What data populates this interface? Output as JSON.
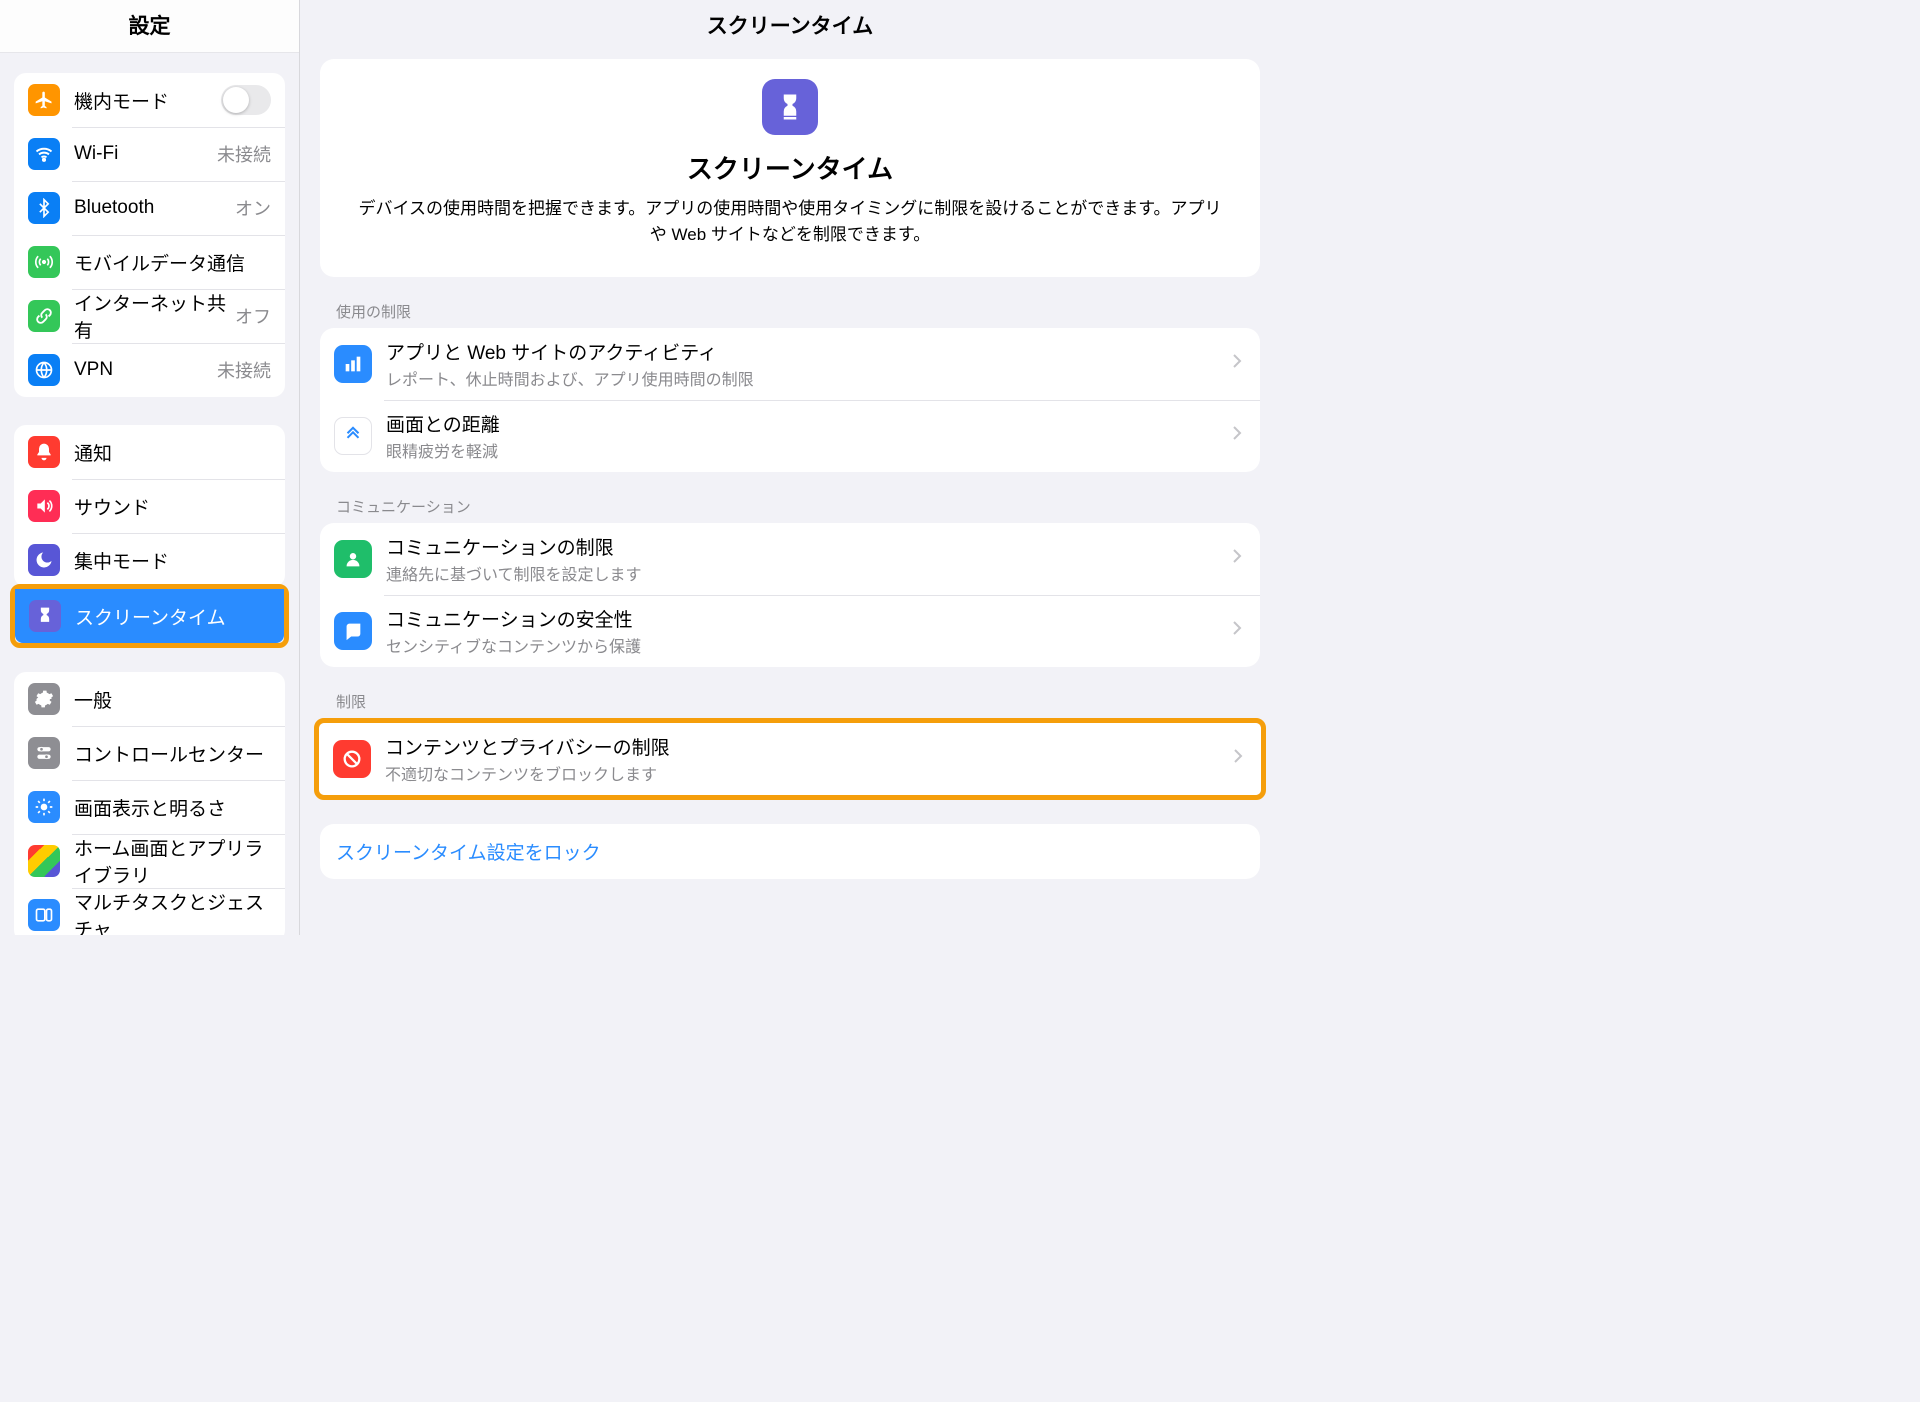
{
  "sidebar": {
    "title": "設定",
    "group1": [
      {
        "label": "機内モード",
        "toggle": true
      },
      {
        "label": "Wi-Fi",
        "value": "未接続"
      },
      {
        "label": "Bluetooth",
        "value": "オン"
      },
      {
        "label": "モバイルデータ通信"
      },
      {
        "label": "インターネット共有",
        "value": "オフ"
      },
      {
        "label": "VPN",
        "value": "未接続"
      }
    ],
    "group2": [
      {
        "label": "通知"
      },
      {
        "label": "サウンド"
      },
      {
        "label": "集中モード"
      },
      {
        "label": "スクリーンタイム",
        "selected": true,
        "highlight": true
      }
    ],
    "group3": [
      {
        "label": "一般"
      },
      {
        "label": "コントロールセンター"
      },
      {
        "label": "画面表示と明るさ"
      },
      {
        "label": "ホーム画面とアプリライブラリ"
      },
      {
        "label": "マルチタスクとジェスチャ"
      }
    ]
  },
  "detail": {
    "title": "スクリーンタイム",
    "hero": {
      "heading": "スクリーンタイム",
      "desc": "デバイスの使用時間を把握できます。アプリの使用時間や使用タイミングに制限を設けることができます。アプリや Web サイトなどを制限できます。"
    },
    "sections": {
      "usage_label": "使用の制限",
      "usage": [
        {
          "title": "アプリと Web サイトのアクティビティ",
          "sub": "レポート、休止時間および、アプリ使用時間の制限"
        },
        {
          "title": "画面との距離",
          "sub": "眼精疲労を軽減"
        }
      ],
      "comm_label": "コミュニケーション",
      "comm": [
        {
          "title": "コミュニケーションの制限",
          "sub": "連絡先に基づいて制限を設定します"
        },
        {
          "title": "コミュニケーションの安全性",
          "sub": "センシティブなコンテンツから保護"
        }
      ],
      "restrict_label": "制限",
      "restrict": [
        {
          "title": "コンテンツとプライバシーの制限",
          "sub": "不適切なコンテンツをブロックします",
          "highlight": true
        }
      ],
      "lock_link": "スクリーンタイム設定をロック"
    }
  }
}
